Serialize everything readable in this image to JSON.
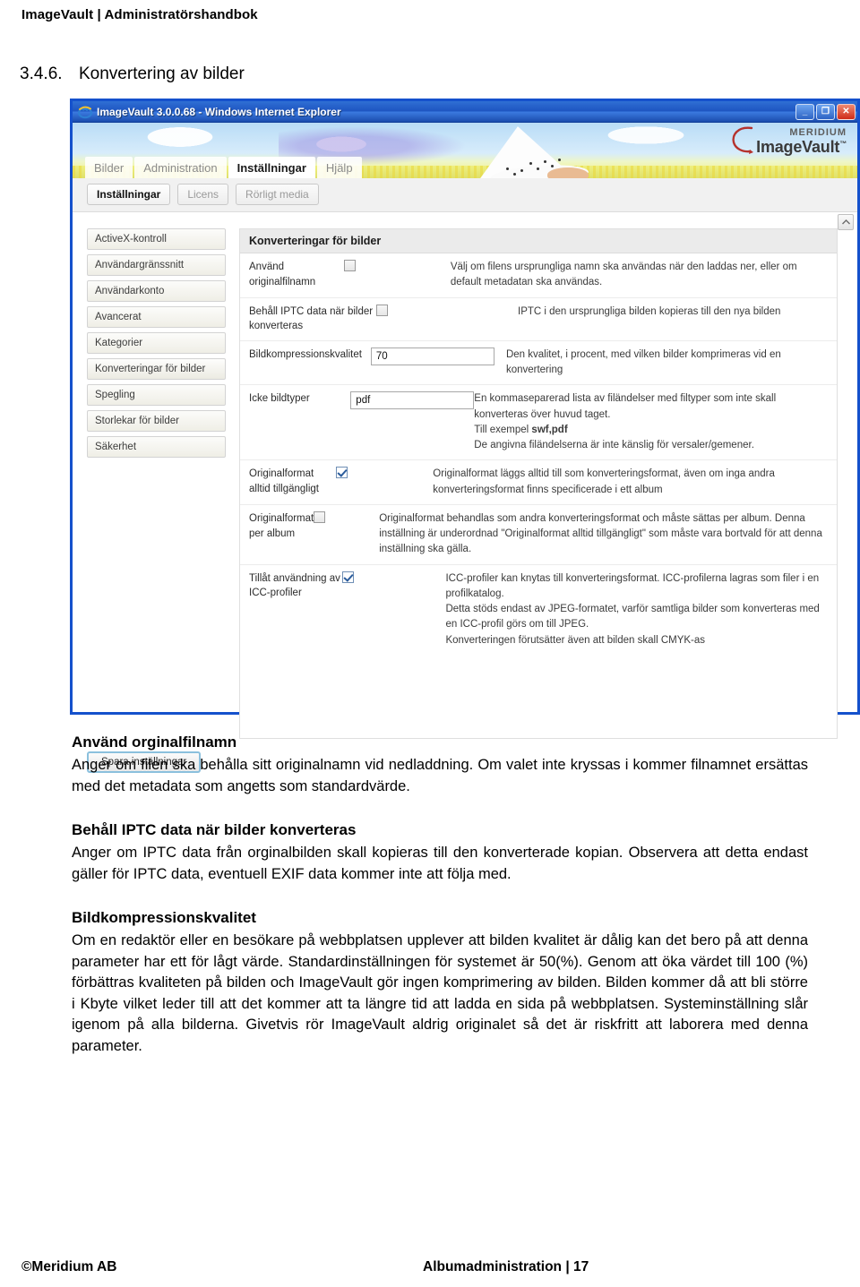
{
  "document": {
    "running_head": "ImageVault | Administratörshandbok",
    "section_number": "3.4.6.",
    "section_title": "Konvertering av bilder",
    "footer_left": "©Meridium AB",
    "footer_right": "Albumadministration | 17"
  },
  "browser": {
    "title": "ImageVault 3.0.0.68 - Windows Internet Explorer",
    "window_buttons": {
      "minimize": "_",
      "maximize": "❐",
      "close": "✕"
    },
    "logo": {
      "brand": "MERIDIUM",
      "product": "ImageVault",
      "trademark": "™"
    },
    "nav_tabs": [
      {
        "label": "Bilder",
        "active": false
      },
      {
        "label": "Administration",
        "active": false
      },
      {
        "label": "Inställningar",
        "active": true
      },
      {
        "label": "Hjälp",
        "active": false
      }
    ],
    "sub_tabs": [
      {
        "label": "Inställningar",
        "active": true
      },
      {
        "label": "Licens",
        "active": false
      },
      {
        "label": "Rörligt media",
        "active": false
      }
    ],
    "sidebar": {
      "items": [
        {
          "label": "ActiveX-kontroll",
          "active": false
        },
        {
          "label": "Användargränssnitt",
          "active": false
        },
        {
          "label": "Användarkonto",
          "active": false
        },
        {
          "label": "Avancerat",
          "active": false
        },
        {
          "label": "Kategorier",
          "active": false
        },
        {
          "label": "Konverteringar för bilder",
          "active": true
        },
        {
          "label": "Spegling",
          "active": false
        },
        {
          "label": "Storlekar för bilder",
          "active": false
        },
        {
          "label": "Säkerhet",
          "active": false
        }
      ]
    },
    "panel": {
      "title": "Konverteringar för bilder",
      "rows": [
        {
          "label": "Använd originalfilnamn",
          "control": "checkbox",
          "checked": false,
          "desc": "Välj om filens ursprungliga namn ska användas när den laddas ner, eller om default metadatan ska användas."
        },
        {
          "label": "Behåll IPTC data när bilder konverteras",
          "control": "checkbox",
          "checked": false,
          "desc": "IPTC i den ursprungliga bilden kopieras till den nya bilden"
        },
        {
          "label": "Bildkompressionskvalitet",
          "control": "text",
          "value": "70",
          "desc": "Den kvalitet, i procent, med vilken bilder komprimeras vid en konvertering"
        },
        {
          "label": "Icke bildtyper",
          "control": "text",
          "value": "pdf",
          "desc": "En kommaseparerad lista av filändelser med filtyper som inte skall konverteras över huvud taget.",
          "desc2_prefix": "Till exempel ",
          "desc2_bold": "swf,pdf",
          "desc3": "De angivna filändelserna är inte känslig för versaler/gemener."
        },
        {
          "label": "Originalformat alltid tillgängligt",
          "control": "checkbox",
          "checked": true,
          "desc": "Originalformat läggs alltid till som konverteringsformat, även om inga andra konverteringsformat finns specificerade i ett album"
        },
        {
          "label": "Originalformat per album",
          "control": "checkbox",
          "checked": false,
          "desc": "Originalformat behandlas som andra konverteringsformat och måste sättas per album. Denna inställning är underordnad \"Originalformat alltid tillgängligt\" som måste vara bortvald för att denna inställning ska gälla."
        },
        {
          "label": "Tillåt användning av ICC-profiler",
          "control": "checkbox",
          "checked": true,
          "desc": "ICC-profiler kan knytas till konverteringsformat. ICC-profilerna lagras som filer i en profilkatalog.",
          "desc2_prefix": "Detta stöds endast av JPEG-formatet, varför samtliga bilder som konverteras med en ICC-profil görs om till JPEG.",
          "desc3": "Konverteringen förutsätter även att bilden skall CMYK-as"
        }
      ],
      "save_label": "Spara inställningar"
    }
  },
  "article": {
    "blocks": [
      {
        "heading": "Använd orginalfilnamn",
        "paragraph": "Anger om filen ska behålla sitt originalnamn vid nedladdning. Om valet inte kryssas i kommer filnamnet ersättas med det metadata som angetts som standardvärde."
      },
      {
        "heading": "Behåll IPTC data när bilder konverteras",
        "paragraph": "Anger om IPTC data från orginalbilden skall kopieras till den konverterade kopian. Observera att detta endast gäller för IPTC data, eventuell EXIF data kommer inte att följa med."
      },
      {
        "heading": "Bildkompressionskvalitet",
        "paragraph": "Om en redaktör eller en besökare på webbplatsen upplever att bilden kvalitet är dålig kan det bero på att denna parameter har ett för lågt värde. Standardinställningen för systemet är 50(%). Genom att öka värdet till 100 (%) förbättras kvaliteten på bilden och ImageVault gör ingen komprimering av bilden. Bilden kommer då att bli större i Kbyte vilket leder till att det kommer att ta längre tid att ladda en sida på webbplatsen. Systeminställning slår igenom på alla bilderna. Givetvis rör ImageVault aldrig originalet så det är riskfritt att laborera med denna parameter."
      }
    ]
  },
  "colors": {
    "titlebar_blue": "#1e55c1",
    "window_border": "#1551cc",
    "close_red": "#cf2b18",
    "panel_header": "#ebebeb"
  }
}
